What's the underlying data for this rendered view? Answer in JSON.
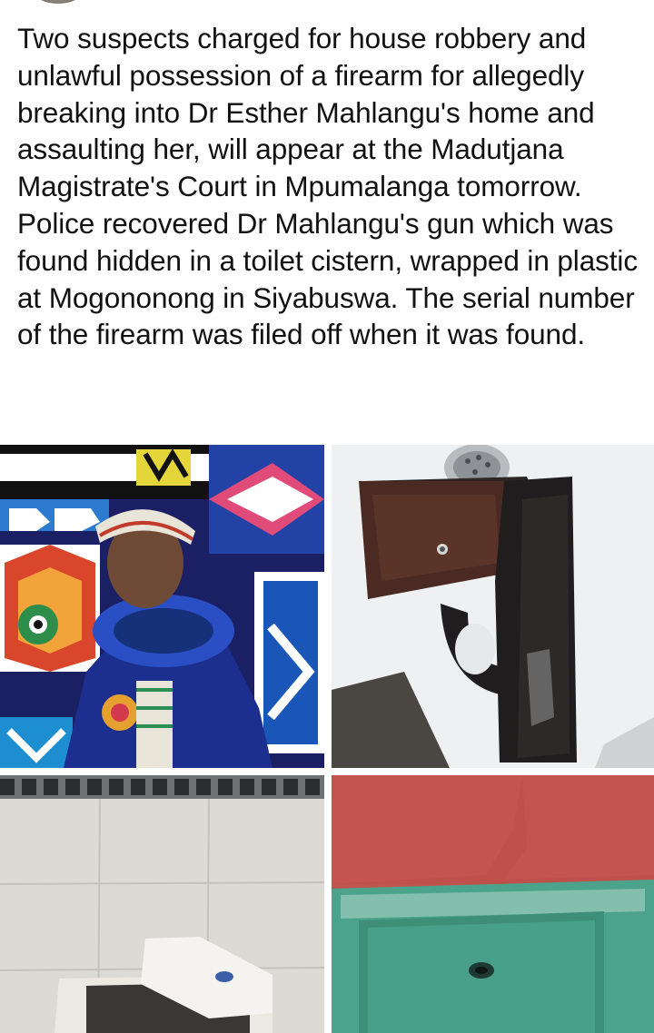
{
  "post": {
    "text": "Two suspects charged for house robbery and unlawful possession of a firearm for allegedly breaking into Dr Esther Mahlangu's home and assaulting her, will appear at the Madutjana Magistrate's Court in Mpumalanga tomorrow. Police recovered Dr Mahlangu's gun which was found hidden in a toilet cistern, wrapped in plastic at Mogononong in Siyabuswa. The serial number of the firearm was filed off when it was found."
  },
  "photos": [
    {
      "subject": "elderly-woman-in-beaded-attire-before-painted-wall"
    },
    {
      "subject": "pistol-on-white-basin"
    },
    {
      "subject": "open-toilet-cistern-on-tiled-wall"
    },
    {
      "subject": "green-box-with-filed-off-area"
    }
  ],
  "colors": {
    "text": "#111111",
    "background": "#ffffff"
  }
}
